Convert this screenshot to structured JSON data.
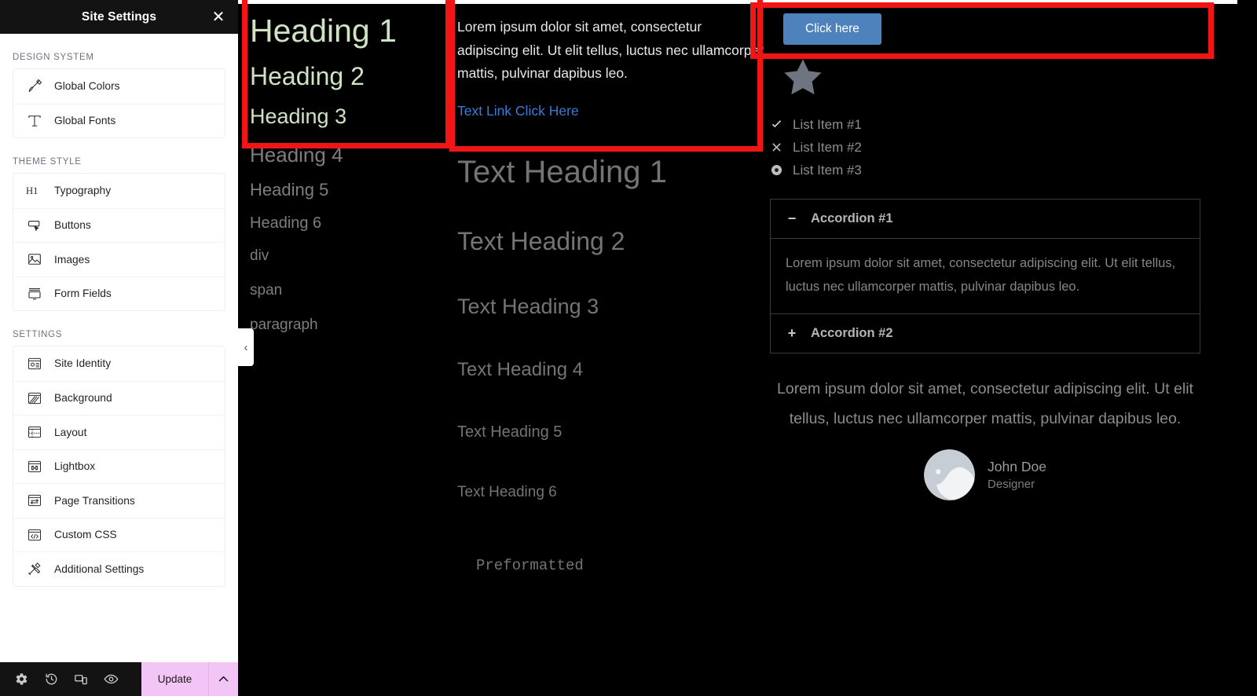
{
  "sidebar": {
    "title": "Site Settings",
    "close_icon": "close-icon",
    "sections": [
      {
        "label": "DESIGN SYSTEM",
        "items": [
          {
            "label": "Global Colors",
            "icon": "brush-icon"
          },
          {
            "label": "Global Fonts",
            "icon": "font-t-icon"
          }
        ]
      },
      {
        "label": "THEME STYLE",
        "items": [
          {
            "label": "Typography",
            "icon": "h1-icon"
          },
          {
            "label": "Buttons",
            "icon": "button-cursor-icon"
          },
          {
            "label": "Images",
            "icon": "image-icon"
          },
          {
            "label": "Form Fields",
            "icon": "form-field-icon"
          }
        ]
      },
      {
        "label": "SETTINGS",
        "items": [
          {
            "label": "Site Identity",
            "icon": "site-identity-icon"
          },
          {
            "label": "Background",
            "icon": "background-icon"
          },
          {
            "label": "Layout",
            "icon": "layout-icon"
          },
          {
            "label": "Lightbox",
            "icon": "lightbox-icon"
          },
          {
            "label": "Page Transitions",
            "icon": "page-transitions-icon"
          },
          {
            "label": "Custom CSS",
            "icon": "code-icon"
          },
          {
            "label": "Additional Settings",
            "icon": "tools-icon"
          }
        ]
      }
    ]
  },
  "bottombar": {
    "icons": [
      "gear-icon",
      "history-icon",
      "responsive-icon",
      "eye-preview-icon"
    ],
    "update_label": "Update",
    "chevron_icon": "chevron-up-icon"
  },
  "collapse_handle": {
    "icon": "chevron-left-icon"
  },
  "canvas": {
    "headings_column": {
      "tinted_color": "#cfe2c3",
      "items": [
        "Heading 1",
        "Heading 2",
        "Heading 3",
        "Heading 4",
        "Heading 5",
        "Heading 6",
        "div",
        "span",
        "paragraph"
      ]
    },
    "middle_column": {
      "paragraph": "Lorem ipsum dolor sit amet, consectetur adipiscing elit. Ut elit tellus, luctus nec ullamcorper mattis, pulvinar dapibus leo.",
      "link_text": "Text Link Click Here",
      "link_color": "#3a7bd5",
      "text_headings": [
        "Text Heading 1",
        "Text Heading 2",
        "Text Heading 3",
        "Text Heading 4",
        "Text Heading 5",
        "Text Heading 6"
      ],
      "preformatted": "Preformatted"
    },
    "right_column": {
      "button_label": "Click here",
      "button_color": "#4d82bd",
      "star_icon": "star-icon",
      "list_items": [
        {
          "icon": "check-icon",
          "label": "List Item #1"
        },
        {
          "icon": "x-icon",
          "label": "List Item #2"
        },
        {
          "icon": "dot-circle-icon",
          "label": "List Item #3"
        }
      ],
      "accordion": [
        {
          "icon": "minus-icon",
          "title": "Accordion #1",
          "open": true,
          "body": "Lorem ipsum dolor sit amet, consectetur adipiscing elit. Ut elit tellus, luctus nec ullamcorper mattis, pulvinar dapibus leo."
        },
        {
          "icon": "plus-icon",
          "title": "Accordion #2",
          "open": false,
          "body": ""
        }
      ],
      "testimonial": {
        "quote": "Lorem ipsum dolor sit amet, consectetur adipiscing elit. Ut elit tellus, luctus nec ullamcorper mattis, pulvinar dapibus leo.",
        "name": "John Doe",
        "role": "Designer",
        "avatar_icon": "avatar-placeholder-icon"
      }
    },
    "annotation_boxes": {
      "color": "#f01616",
      "count": 3
    }
  }
}
